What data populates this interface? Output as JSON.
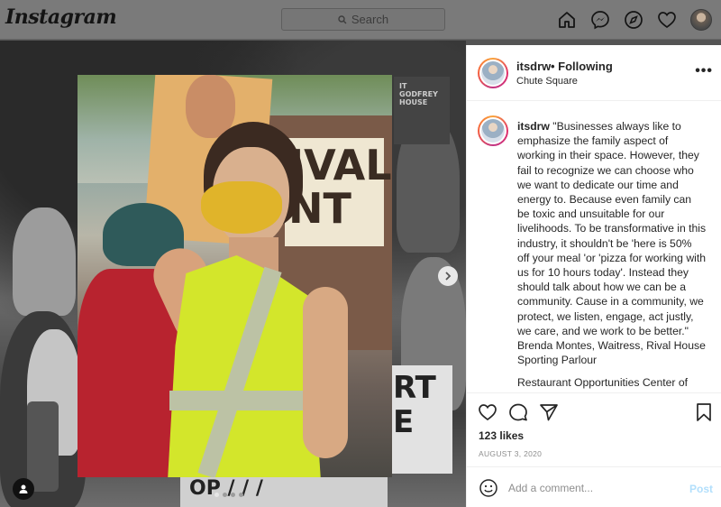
{
  "nav": {
    "logo": "Instagram",
    "search_placeholder": "Search",
    "icons": [
      "home-icon",
      "messenger-icon",
      "explore-icon",
      "heart-icon",
      "profile-avatar"
    ]
  },
  "photo": {
    "sign_text": "IVAL\nNT",
    "carousel": {
      "total_dots": 4,
      "active_index": 0
    },
    "next_arrow": "chevron-right-icon"
  },
  "post": {
    "username": "itsdrw",
    "follow_status": "• Following",
    "location": "Chute Square",
    "more": "•••",
    "caption_username": "itsdrw",
    "caption_text": "\"Businesses always like to emphasize the family aspect of working in their space. However, they fail to recognize we can choose who we want to dedicate our time and energy to. Because even family can be toxic and unsuitable for our livelihoods. To be transformative in this industry, it shouldn't be 'here is 50% off your meal 'or 'pizza for working with us for 10 hours today'. Instead they should talk about how we can be a community. Cause in a community, we protect, we listen, engage, act justly, we care, and we work to be better.\" Brenda Montes, Waitress, Rival House Sporting Parlour",
    "caption_continued": "Restaurant Opportunities Center of",
    "likes": "123 likes",
    "date": "AUGUST 3, 2020",
    "comment_placeholder": "Add a comment...",
    "post_label": "Post"
  },
  "colors": {
    "text": "#262626",
    "muted": "#8e8e8e",
    "post_button_disabled": "#b2dffc",
    "vest": "#d3e62b",
    "mask": "#e0b42a"
  }
}
